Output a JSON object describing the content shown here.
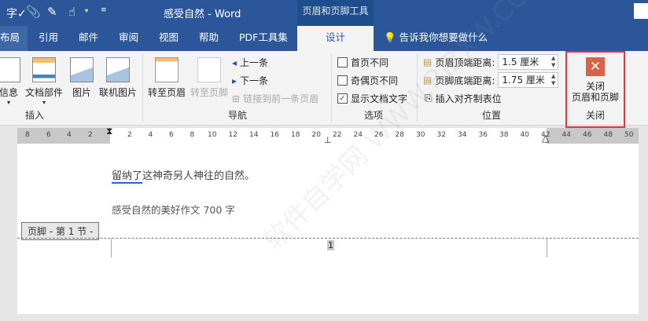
{
  "title": {
    "doc": "感受自然",
    "sep": "-",
    "app": "Word",
    "context_tool": "页眉和页脚工具"
  },
  "tabs": [
    "布局",
    "引用",
    "邮件",
    "审阅",
    "视图",
    "帮助",
    "PDF工具集",
    "设计"
  ],
  "tell_me": "告诉我你想要做什么",
  "ribbon": {
    "insert": {
      "items": [
        "信息",
        "文档部件",
        "图片",
        "联机图片"
      ],
      "label": "插入"
    },
    "nav": {
      "goto_header": "转至页眉",
      "goto_footer": "转至页脚",
      "prev": "上一条",
      "next": "下一条",
      "link": "链接到前一条页眉",
      "label": "导航"
    },
    "options": {
      "first_diff": "首页不同",
      "odd_even": "奇偶页不同",
      "show_text": "显示文档文字",
      "first_checked": false,
      "odd_checked": false,
      "show_checked": true,
      "label": "选项"
    },
    "position": {
      "header_dist_label": "页眉顶端距离:",
      "header_dist": "1.5 厘米",
      "footer_dist_label": "页脚底端距离:",
      "footer_dist": "1.75 厘米",
      "align_tab": "插入对齐制表位",
      "label": "位置"
    },
    "close": {
      "line1": "关闭",
      "line2": "页眉和页脚",
      "label": "关闭"
    }
  },
  "ruler": {
    "left": [
      "8",
      "6",
      "4",
      "2"
    ],
    "right": [
      "2",
      "4",
      "6",
      "8",
      "10",
      "12",
      "14",
      "16",
      "18",
      "20",
      "22",
      "24",
      "26",
      "28",
      "30",
      "32",
      "34",
      "36",
      "38",
      "40",
      "42",
      "44",
      "46",
      "48",
      "50"
    ]
  },
  "document": {
    "line1_underlined": "留纳了",
    "line1_rest": "这神奇另人神往的自然。",
    "line2": "感受自然的美好作文 700 字",
    "footer_tag": "页脚 - 第 1 节 -",
    "page_number": "1"
  },
  "watermark": "软件自学网 WWW.RJZXW.COM",
  "colors": {
    "accent": "#2b579a",
    "close_red": "#d9534f",
    "highlight": "#e8333a"
  }
}
